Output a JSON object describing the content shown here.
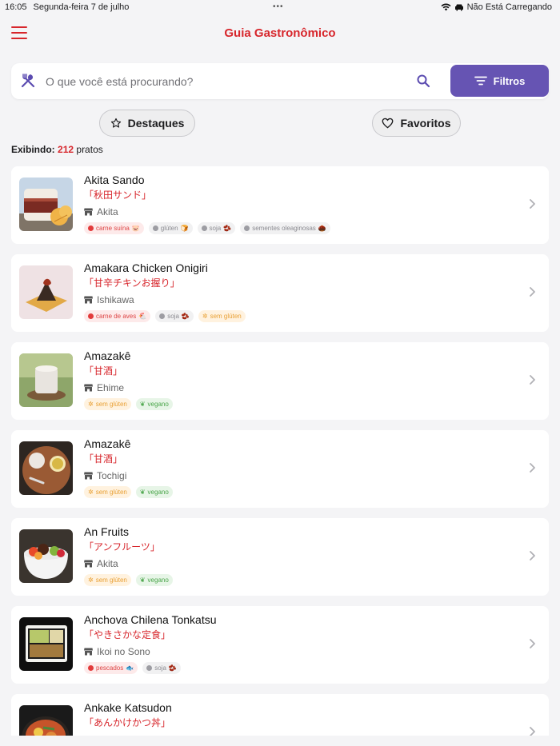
{
  "status_bar": {
    "time": "16:05",
    "date": "Segunda-feira 7 de julho",
    "battery_text": "Não Está Carregando"
  },
  "nav": {
    "title": "Guia Gastronômico"
  },
  "search": {
    "placeholder": "O que você está procurando?",
    "value": "",
    "filter_label": "Filtros"
  },
  "quick_filters": {
    "highlights": "Destaques",
    "favorites": "Favoritos"
  },
  "summary": {
    "label": "Exibindo:",
    "count": "212",
    "unit": "pratos"
  },
  "colors": {
    "accent_red": "#d7262c",
    "brand_purple": "#6654b3"
  },
  "dishes": [
    {
      "name": "Akita Sando",
      "jp": "「秋田サンド」",
      "location": "Akita",
      "tags": [
        {
          "label": "carne suína",
          "type": "allergen",
          "icon": "pig-icon"
        },
        {
          "label": "glúten",
          "type": "neutral",
          "icon": "bread-icon"
        },
        {
          "label": "soja",
          "type": "neutral",
          "icon": "bean-icon"
        },
        {
          "label": "sementes oleaginosas",
          "type": "neutral",
          "icon": "nut-icon"
        }
      ]
    },
    {
      "name": "Amakara Chicken Onigiri",
      "jp": "「甘辛チキンお握り」",
      "location": "Ishikawa",
      "tags": [
        {
          "label": "carne de aves",
          "type": "allergen",
          "icon": "chicken-icon"
        },
        {
          "label": "soja",
          "type": "neutral",
          "icon": "bean-icon"
        },
        {
          "label": "sem glúten",
          "type": "gf",
          "icon": "wheat-off-icon"
        }
      ]
    },
    {
      "name": "Amazakê",
      "jp": "「甘酒」",
      "location": "Ehime",
      "tags": [
        {
          "label": "sem glúten",
          "type": "gf",
          "icon": "wheat-off-icon"
        },
        {
          "label": "vegano",
          "type": "vegan",
          "icon": "leaf-icon"
        }
      ]
    },
    {
      "name": "Amazakê",
      "jp": "「甘酒」",
      "location": "Tochigi",
      "tags": [
        {
          "label": "sem glúten",
          "type": "gf",
          "icon": "wheat-off-icon"
        },
        {
          "label": "vegano",
          "type": "vegan",
          "icon": "leaf-icon"
        }
      ]
    },
    {
      "name": "An Fruits",
      "jp": "「アンフルーツ」",
      "location": "Akita",
      "tags": [
        {
          "label": "sem glúten",
          "type": "gf",
          "icon": "wheat-off-icon"
        },
        {
          "label": "vegano",
          "type": "vegan",
          "icon": "leaf-icon"
        }
      ]
    },
    {
      "name": "Anchova Chilena Tonkatsu",
      "jp": "「やきさかな定食」",
      "location": "Ikoi no Sono",
      "tags": [
        {
          "label": "pescados",
          "type": "allergen",
          "icon": "fish-icon"
        },
        {
          "label": "soja",
          "type": "neutral",
          "icon": "bean-icon"
        }
      ]
    },
    {
      "name": "Ankake Katsudon",
      "jp": "「あんかけかつ丼」",
      "location": "",
      "tags": []
    }
  ]
}
